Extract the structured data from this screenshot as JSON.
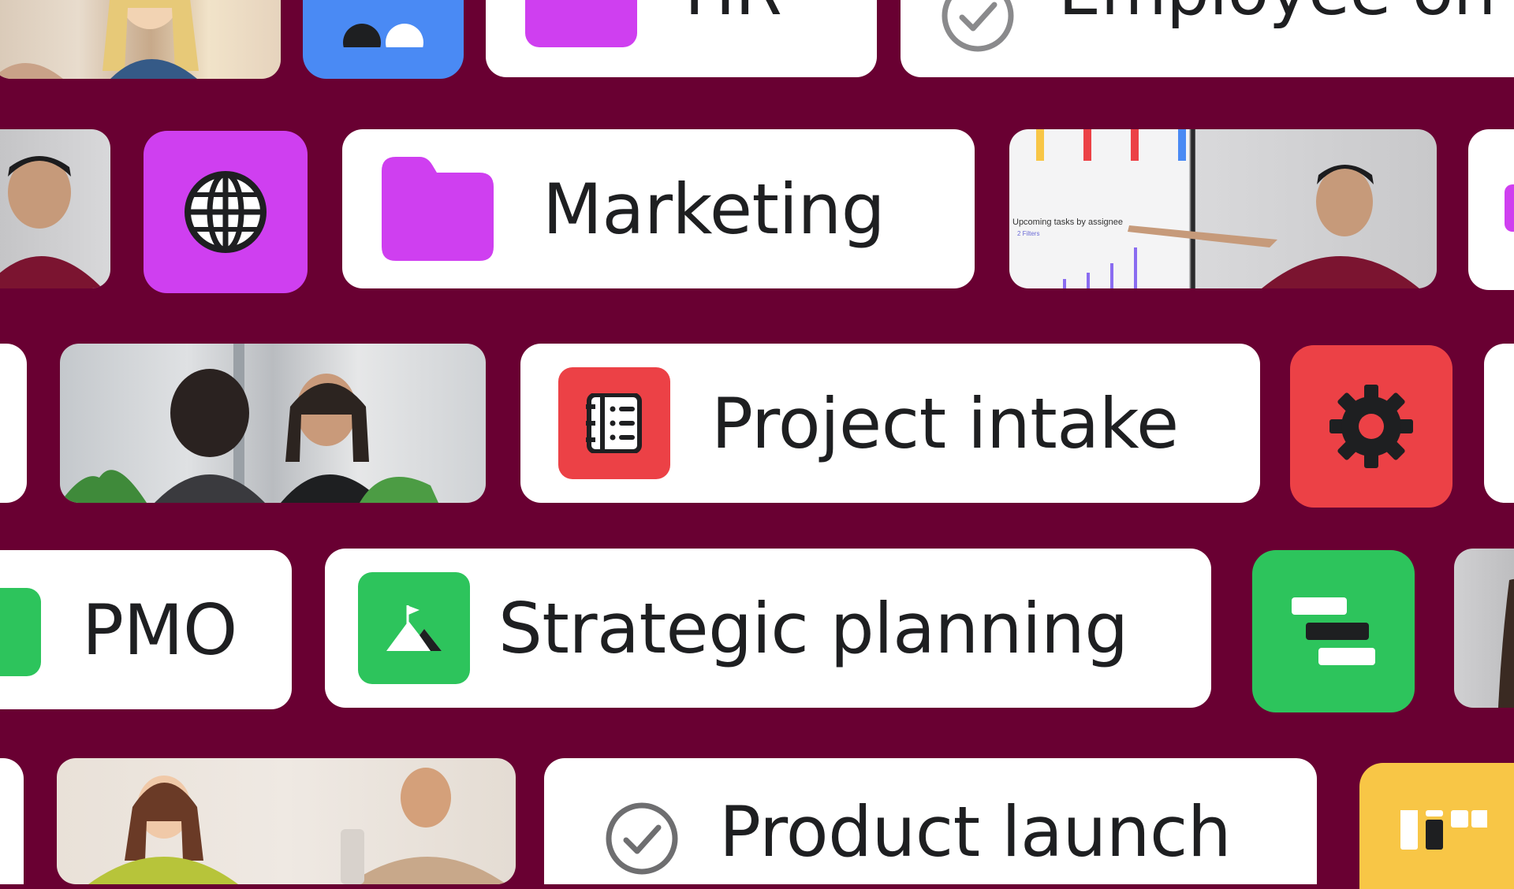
{
  "labels": {
    "hr": "HR",
    "employee": "Employee on",
    "marketing": "Marketing",
    "project_intake": "Project intake",
    "pmo": "PMO",
    "strategic_planning": "Strategic planning",
    "product_launch": "Product launch"
  },
  "chart_screen": {
    "caption": "Upcoming tasks by assignee",
    "subcaption": "2 Filters"
  },
  "icons": {
    "hr_pill": "folder-icon",
    "employee_pill": "check-circle-icon",
    "marketing_square": "globe-icon",
    "marketing_pill": "folder-icon",
    "project_pill": "notebook-icon",
    "project_square": "gear-icon",
    "pmo_pill": "folder-icon",
    "strategic_pill": "mountain-flag-icon",
    "strategic_square": "timeline-icon",
    "launch_pill": "check-circle-icon",
    "launch_square": "board-icon",
    "hr_square": "people-icon"
  },
  "colors": {
    "background": "#690032",
    "purple": "#cf3ff0",
    "blue": "#4a8af4",
    "red": "#ec4146",
    "green": "#2dc45c",
    "yellow": "#f8c646",
    "text": "#1e1f21"
  }
}
